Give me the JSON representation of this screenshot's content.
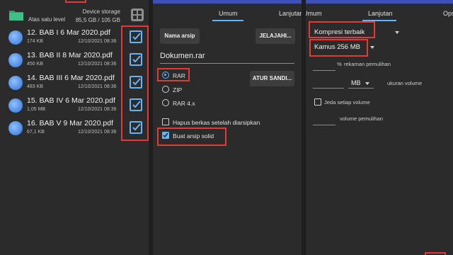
{
  "file_panel": {
    "crumb_label": "Atas satu level",
    "storage_title": "Device storage",
    "storage_usage": "85,5 GB / 105 GB",
    "files": [
      {
        "name": "12. BAB I 6 Mar 2020.pdf",
        "size": "174 KB",
        "date": "12/10/2021 08:36"
      },
      {
        "name": "13. BAB II 8 Mar 2020.pdf",
        "size": "450 KB",
        "date": "12/10/2021 08:36"
      },
      {
        "name": "14. BAB III 6 Mar 2020.pdf",
        "size": "483 KB",
        "date": "12/10/2021 08:36"
      },
      {
        "name": "15. BAB IV 6 Mar 2020.pdf",
        "size": "1,05 MB",
        "date": "12/10/2021 08:36"
      },
      {
        "name": "16. BAB V 9 Mar 2020.pdf",
        "size": "67,1 KB",
        "date": "12/10/2021 08:36"
      }
    ]
  },
  "general_panel": {
    "tab_general": "Umum",
    "tab_advanced_partial": "Lanjutan",
    "archive_name_button": "Nama arsip",
    "browse_button": "JELAJAHI...",
    "archive_name_value": "Dokumen.rar",
    "formats": [
      "RAR",
      "ZIP",
      "RAR 4.x"
    ],
    "selected_format": "RAR",
    "set_password_button": "ATUR SANDI...",
    "delete_after_label": "Hapus berkas setelah diarsipkan",
    "solid_archive_label": "Buat arsip solid"
  },
  "advanced_panel": {
    "tab_general_partial": "Umum",
    "tab_advanced": "Lanjutan",
    "tab_options_partial": "Ops",
    "compression_value": "Kompresi terbaik",
    "dictionary_value": "Kamus 256 MB",
    "recovery_record_label": "rekaman pemulihan",
    "percent_unit": "%",
    "volume_unit": "MB",
    "volume_size_label": "ukuran volume",
    "pause_volume_label": "Jeda setiap volume",
    "recovery_volume_label": "volume pemulihan"
  },
  "colors": {
    "accent": "#64b5f6",
    "highlight": "#e53935",
    "panel_bg": "#2b2b2b"
  }
}
